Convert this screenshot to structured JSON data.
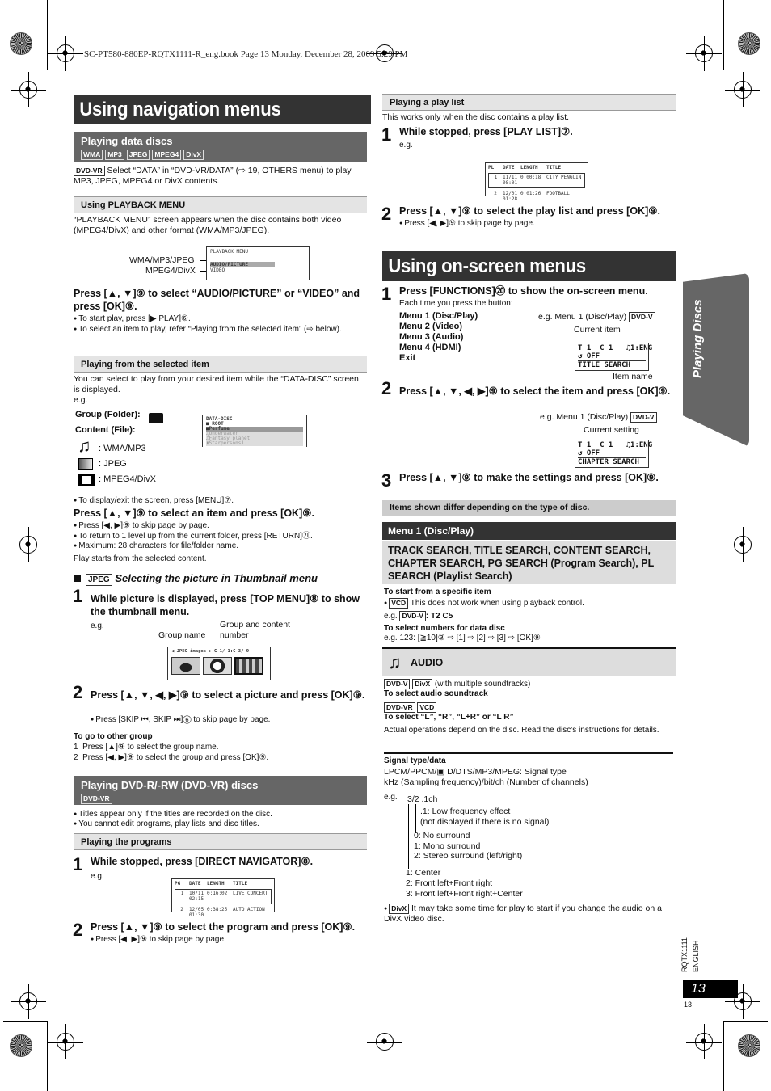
{
  "print_header": "SC-PT580-880EP-RQTX1111-R_eng.book  Page 13  Monday, December 28, 2009  5:29 PM",
  "left": {
    "title": "Using navigation menus",
    "data_discs": {
      "heading": "Playing data discs",
      "tags": [
        "WMA",
        "MP3",
        "JPEG",
        "MPEG4",
        "DivX"
      ],
      "intro_tag": "DVD-VR",
      "intro": "Select “DATA” in “DVD-VR/DATA” (⇨ 19, OTHERS menu) to play MP3, JPEG, MPEG4 or DivX contents."
    },
    "playback_menu": {
      "heading": "Using PLAYBACK MENU",
      "text": "“PLAYBACK MENU” screen appears when the disc contains both video (MPEG4/DivX) and other format (WMA/MP3/JPEG).",
      "label1": "WMA/MP3/JPEG",
      "label2": "MPEG4/DivX",
      "screen_title": "PLAYBACK MENU",
      "screen_item1": "AUDIO/PICTURE",
      "screen_item2": "VIDEO",
      "instruction": "Press [▲, ▼]⑨ to select “AUDIO/PICTURE” or “VIDEO” and press [OK]⑨.",
      "bullet1": "To start play, press [▶ PLAY]⑥.",
      "bullet2": "To select an item to play, refer “Playing from the selected item” (⇨ below)."
    },
    "selected_item": {
      "heading": "Playing from the selected item",
      "text": "You can select to play from your desired item while the “DATA-DISC” screen is displayed.",
      "eg": "e.g.",
      "group_label": "Group (Folder):",
      "content_label": "Content (File):",
      "type_wma": ": WMA/MP3",
      "type_jpeg": ": JPEG",
      "type_mpeg4": ": MPEG4/DivX",
      "screen_rows": [
        "DATA-DISC",
        "ROOT",
        "Perfume",
        "Underwater",
        "Fantasy planet",
        "Starpersons1"
      ],
      "bullet_menu": "To display/exit the screen, press [MENU]⑦.",
      "instruction": "Press [▲, ▼]⑨ to select an item and press [OK]⑨.",
      "bullets": [
        "Press [◀, ▶]⑨ to skip page by page.",
        "To return to 1 level up from the current folder, press [RETURN]㉑.",
        "Maximum: 28 characters for file/folder name."
      ],
      "after": "Play starts from the selected content."
    },
    "thumbnail": {
      "tag": "JPEG",
      "heading": "Selecting the picture in Thumbnail menu",
      "step1": "While picture is displayed, press [TOP MENU]⑧ to show the thumbnail menu.",
      "eg": "e.g.",
      "label_group_name": "Group name",
      "label_group_content": "Group and content number",
      "screen_header": "◀ JPEG images ▶ G 1/ 1:C 3/ 9",
      "step2": "Press [▲, ▼, ◀, ▶]⑨ to select a picture and press [OK]⑨.",
      "step2_bullet": "Press [SKIP ⏮, SKIP ⏭]⑥ to skip page by page.",
      "other_group_heading": "To go to other group",
      "other_group_steps": [
        "1  Press [▲]⑨ to select the group name.",
        "2  Press [◀, ▶]⑨ to select the group and press [OK]⑨."
      ]
    },
    "dvd_vr": {
      "heading": "Playing DVD-R/-RW (DVD-VR) discs",
      "tag": "DVD-VR",
      "bullets": [
        "Titles appear only if the titles are recorded on the disc.",
        "You cannot edit programs, play lists and disc titles."
      ],
      "programs_heading": "Playing the programs",
      "step1": "While stopped, press [DIRECT NAVIGATOR]⑧.",
      "eg": "e.g.",
      "table_headers": [
        "PG",
        "DATE",
        "LENGTH",
        "TITLE"
      ],
      "table_rows": [
        [
          "1",
          "10/11 02:15",
          "0:16:02",
          "LIVE CONCERT"
        ],
        [
          "2",
          "12/05 01:30",
          "0:38:25",
          "AUTO ACTION"
        ]
      ],
      "step2": "Press [▲, ▼]⑨ to select the program and press [OK]⑨.",
      "step2_bullet": "Press [◀, ▶]⑨ to skip page by page."
    }
  },
  "right": {
    "playlist": {
      "heading": "Playing a play list",
      "text": "This works only when the disc contains a play list.",
      "step1": "While stopped, press [PLAY LIST]⑦.",
      "eg": "e.g.",
      "table_headers": [
        "PL",
        "DATE",
        "LENGTH",
        "TITLE"
      ],
      "table_rows": [
        [
          "1",
          "11/11 08:01",
          "0:00:18",
          "CITY PENGUIN"
        ],
        [
          "2",
          "12/01 01:28",
          "0:01:26",
          "FOOTBALL"
        ]
      ],
      "step2": "Press [▲, ▼]⑨ to select the play list and press [OK]⑨.",
      "step2_bullet": "Press [◀, ▶]⑨ to skip page by page."
    },
    "onscreen": {
      "title": "Using on-screen menus",
      "step1": "Press [FUNCTIONS]⑳ to show the on-screen menu.",
      "step1_sub": "Each time you press the button:",
      "menus": [
        "Menu 1 (Disc/Play)",
        "Menu 2 (Video)",
        "Menu 3 (Audio)",
        "Menu 4 (HDMI)",
        "Exit"
      ],
      "eg1": "e.g. Menu 1 (Disc/Play)",
      "eg_tag": "DVD-V",
      "current_item": "Current item",
      "osd1_line1": "T 1  C 1   ♫1:ENG",
      "osd1_line2": "↺ OFF",
      "osd1_line3": "TITLE  SEARCH",
      "item_name": "Item name",
      "step2": "Press [▲, ▼, ◀, ▶]⑨ to select the item and press [OK]⑨.",
      "eg2": "e.g. Menu 1 (Disc/Play)",
      "current_setting": "Current setting",
      "osd2_line1": "T 1  C 1   ♫1:ENG",
      "osd2_line2": "↺ OFF",
      "osd2_line3": "CHAPTER  SEARCH",
      "step3": "Press [▲, ▼]⑨ to make the settings and press [OK]⑨.",
      "note": "Items shown differ depending on the type of disc."
    },
    "menu1": {
      "heading": "Menu 1 (Disc/Play)",
      "search_block": "TRACK SEARCH, TITLE SEARCH, CONTENT SEARCH, CHAPTER SEARCH, PG SEARCH (Program Search), PL SEARCH (Playlist Search)",
      "specific_heading": "To start from a specific item",
      "vcd_tag": "VCD",
      "vcd_note": "This does not work when using playback control.",
      "eg_prefix": "e.g.",
      "eg_tag": "DVD-V",
      "eg_value": ": T2 C5",
      "numbers_heading": "To select numbers for data disc",
      "numbers_eg": "e.g. 123: [≧10]③ ⇨ [1] ⇨ [2] ⇨ [3] ⇨ [OK]⑨"
    },
    "audio": {
      "heading": "AUDIO",
      "tags1": [
        "DVD-V",
        "DivX"
      ],
      "tags1_note": "(with multiple soundtracks)",
      "select_soundtrack": "To select audio soundtrack",
      "tags2": [
        "DVD-VR",
        "VCD"
      ],
      "select_lr": "To select “L”, “R”, “L+R” or “L R”",
      "actual": "Actual operations depend on the disc. Read the disc’s instructions for details.",
      "signal_heading": "Signal type/data",
      "signal_line1": "LPCM/PPCM/▣ D/DTS/MP3/MPEG:  Signal type",
      "signal_line2": "kHz (Sampling frequency)/bit/ch (Number of channels)",
      "eg": "e.g.",
      "eg_value": "3/2 .1ch",
      "lfe1": ".1:  Low frequency effect",
      "lfe2": "(not displayed if there is no signal)",
      "surround": [
        "0:  No surround",
        "1:  Mono surround",
        "2:  Stereo surround (left/right)"
      ],
      "front": [
        "1:  Center",
        "2:  Front left+Front right",
        "3:  Front left+Front right+Center"
      ],
      "divx_tag": "DivX",
      "divx_note": "It may take some time for play to start if you change the audio on a DivX video disc."
    }
  },
  "side_tab": "Playing Discs",
  "footer": {
    "doc_code": "RQTX1111",
    "language": "ENGLISH",
    "page_box": "13",
    "page_small": "13"
  }
}
